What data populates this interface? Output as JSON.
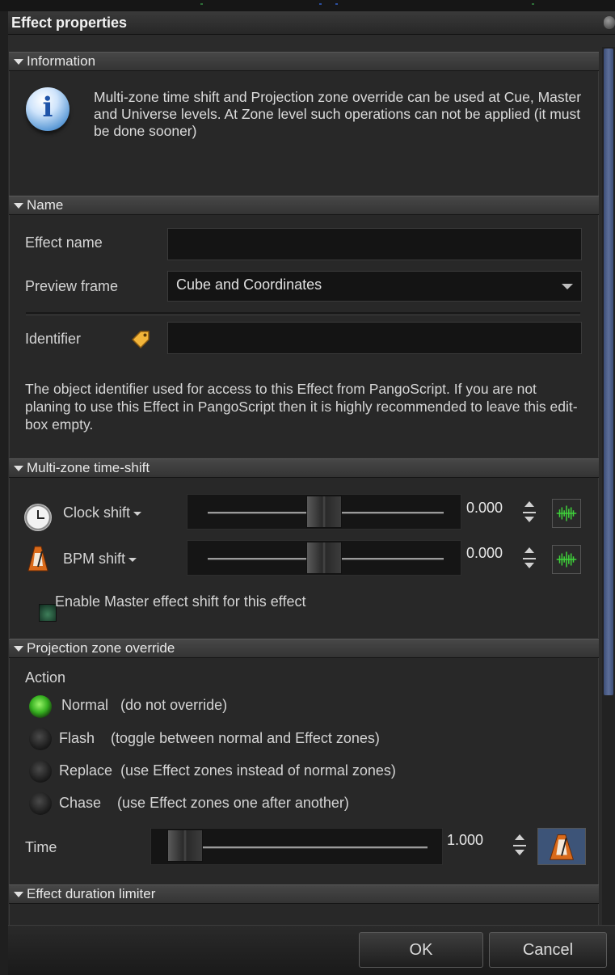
{
  "window": {
    "title": "Effect properties"
  },
  "sections": {
    "information": "Information",
    "name": "Name",
    "timeshift": "Multi-zone time-shift",
    "projection": "Projection zone  override",
    "duration": "Effect duration limiter"
  },
  "information": {
    "icon": "info-icon",
    "text": "Multi-zone  time shift and Projection zone override can be used at Cue, Master and Universe levels. At  Zone level such operations can not be applied (it must be done sooner)"
  },
  "name_section": {
    "effect_name_label": "Effect name",
    "effect_name_value": "",
    "preview_frame_label": "Preview frame",
    "preview_frame_value": "Cube and Coordinates",
    "identifier_label": "Identifier",
    "identifier_value": "",
    "help": "The object identifier used for access to this Effect from PangoScript. If you are not planing to use this Effect in PangoScript then it is highly recommended to leave this edit-box empty."
  },
  "timeshift": {
    "clock_label": "Clock shift",
    "clock_value": "0.000",
    "clock_slider_fraction": 0.5,
    "bpm_label": "BPM shift",
    "bpm_value": "0.000",
    "bpm_slider_fraction": 0.5,
    "enable_master": "Enable Master effect shift for this effect",
    "enable_master_checked": false
  },
  "projection": {
    "action_label": "Action",
    "options": [
      {
        "name": "Normal",
        "desc": "(do not override)",
        "selected": true
      },
      {
        "name": "Flash",
        "desc": "(toggle between normal and Effect zones)",
        "selected": false
      },
      {
        "name": "Replace",
        "desc": "(use Effect zones instead of normal zones)",
        "selected": false
      },
      {
        "name": "Chase",
        "desc": "(use Effect zones one after another)",
        "selected": false
      }
    ],
    "time_label": "Time",
    "time_value": "1.000",
    "time_slider_fraction": 0.0
  },
  "buttons": {
    "ok": "OK",
    "cancel": "Cancel"
  },
  "colors": {
    "accent_green": "#36b020",
    "scrollbar": "#4f6190"
  }
}
